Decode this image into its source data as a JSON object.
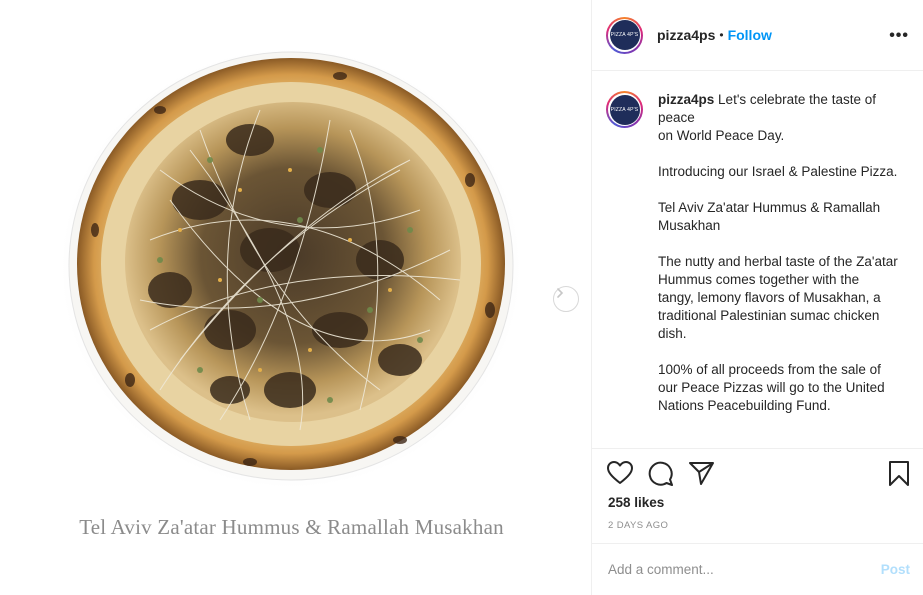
{
  "post": {
    "username": "pizza4ps",
    "avatar_text": "PIZZA 4P'S",
    "follow_label": "Follow",
    "separator": "•",
    "more_label": "•••",
    "image_caption": "Tel Aviv Za'atar Hummus & Ramallah Musakhan",
    "caption_paragraphs": [
      "Let's celebrate the taste of peace\non World Peace Day.",
      "Introducing our Israel & Palestine Pizza.",
      "Tel Aviv Za'atar Hummus & Ramallah Musakhan",
      "The nutty and herbal taste of the Za'atar Hummus comes together with the tangy, lemony flavors of Musakhan, a traditional Palestinian sumac chicken dish.",
      "100% of all proceeds from the sale of our Peace Pizzas will go to the United Nations Peacebuilding Fund."
    ],
    "likes": "258 likes",
    "timestamp": "2 DAYS AGO"
  },
  "comment_box": {
    "placeholder": "Add a comment...",
    "post_label": "Post"
  },
  "icons": {
    "like": "heart-icon",
    "comment": "comment-icon",
    "share": "paper-plane-icon",
    "save": "bookmark-icon",
    "next": "chevron-right-icon"
  },
  "colors": {
    "follow": "#0095f6",
    "post_disabled": "#b2dffc",
    "border": "#efefef",
    "muted": "#8e8e8e"
  }
}
